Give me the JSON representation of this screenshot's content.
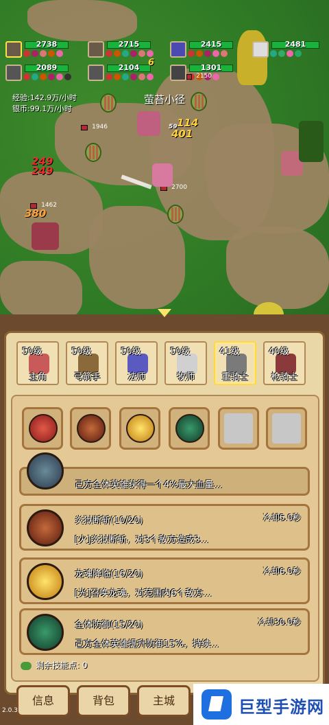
{
  "battle": {
    "heroes": [
      {
        "hp": "2738",
        "selected": true
      },
      {
        "hp": "2715",
        "selected": false
      },
      {
        "hp": "2415",
        "selected": false
      },
      {
        "hp": "2481",
        "selected": false
      },
      {
        "hp": "2089",
        "selected": false
      },
      {
        "hp": "2104",
        "selected": false
      },
      {
        "hp": "1301",
        "selected": false
      }
    ],
    "exp_rate": "经验:142.9万/小时",
    "silver_rate": "银币:99.1万/小时",
    "map_name": "萤苔小径",
    "floating_numbers": [
      "114",
      "401",
      "249",
      "249",
      "380",
      "59"
    ],
    "enemy_hp_labels": [
      "1946",
      "2700",
      "1462",
      "2150"
    ],
    "extra_number": "6"
  },
  "hero_tabs": [
    {
      "level": "50级",
      "role": "主角",
      "color": "#c95a5a"
    },
    {
      "level": "50级",
      "role": "弓箭手",
      "color": "#8a6a3a"
    },
    {
      "level": "50级",
      "role": "法师",
      "color": "#5a5ac0"
    },
    {
      "level": "50级",
      "role": "牧师",
      "color": "#d0d0d0"
    },
    {
      "level": "41级",
      "role": "重骑士",
      "color": "#7a7a7a",
      "selected": true
    },
    {
      "level": "40级",
      "role": "枪骑士",
      "color": "#8a3a3a"
    }
  ],
  "skill_slots": [
    {
      "icon": "fire-sword-icon",
      "color": "#c0302a",
      "empty": false
    },
    {
      "icon": "inferno-blade-icon",
      "color": "#7a2a1a",
      "empty": false
    },
    {
      "icon": "dragon-soul-icon",
      "color": "#e0a018",
      "empty": false
    },
    {
      "icon": "shield-defense-icon",
      "color": "#1e6e4a",
      "empty": false
    },
    {
      "icon": "empty-slot",
      "empty": true
    },
    {
      "icon": "empty-slot",
      "empty": true
    }
  ],
  "skills": [
    {
      "name": "",
      "cooldown": "",
      "desc": "己方全体英雄获得一个4%最大血量...",
      "icon": "shield-orb-icon",
      "color": "#4a6a7a"
    },
    {
      "name": "炎狱断斩(10/20)",
      "cooldown": "冷却5.0秒",
      "desc": "[火]炎狱断斩，对3个敌方造成3...",
      "icon": "inferno-blade-icon",
      "color": "#7a2a1a"
    },
    {
      "name": "龙魂降临(16/20)",
      "cooldown": "冷却6.0秒",
      "desc": "[光]召唤龙魂，对范围内6个敌方...",
      "icon": "dragon-soul-icon",
      "color": "#e0a018"
    },
    {
      "name": "全体防御(15/20)",
      "cooldown": "冷却30.0秒",
      "desc": "己方全体英雄提升防御15%，持续...",
      "icon": "shield-defense-icon",
      "color": "#1e6e4a"
    }
  ],
  "remaining_points": "剩余技能点:  0",
  "nav": {
    "info": "信息",
    "bag": "背包",
    "city": "主城"
  },
  "version": "2.0.3",
  "watermark": "巨型手游网"
}
